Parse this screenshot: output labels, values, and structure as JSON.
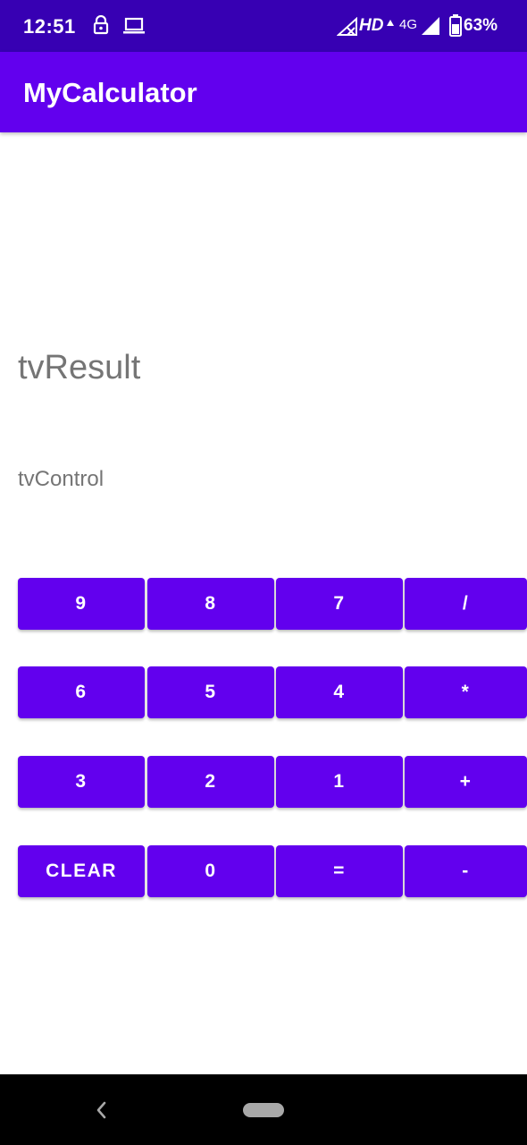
{
  "status_bar": {
    "time": "12:51",
    "network_label": "HD",
    "network_type": "4G",
    "battery": "63%",
    "icons": [
      "lock-icon",
      "laptop-icon",
      "no-signal-icon",
      "data-arrow-icon",
      "signal-icon",
      "battery-icon"
    ]
  },
  "app_bar": {
    "title": "MyCalculator",
    "color": "#6200ee"
  },
  "display": {
    "result": "tvResult",
    "control": "tvControl"
  },
  "keypad": {
    "rows": [
      [
        "9",
        "8",
        "7",
        "/"
      ],
      [
        "6",
        "5",
        "4",
        "*"
      ],
      [
        "3",
        "2",
        "1",
        "+"
      ],
      [
        "CLEAR",
        "0",
        "=",
        "-"
      ]
    ],
    "button_color": "#6200ee"
  },
  "nav_bar": {
    "icons": [
      "back-icon",
      "home-pill-icon"
    ]
  }
}
